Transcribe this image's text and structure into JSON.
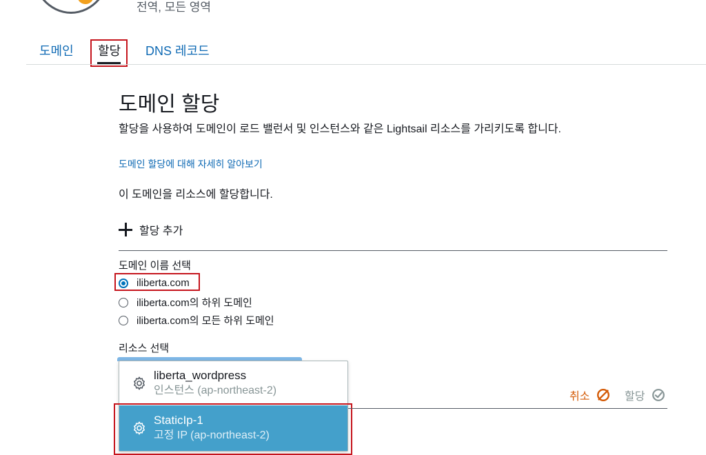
{
  "header": {
    "scope_text": "전역, 모든 영역"
  },
  "tabs": [
    {
      "label": "도메인",
      "active": false
    },
    {
      "label": "할당",
      "active": true
    },
    {
      "label": "DNS 레코드",
      "active": false
    }
  ],
  "section": {
    "title": "도메인 할당",
    "description": "할당을 사용하여 도메인이 로드 밸런서 및 인스턴스와 같은 Lightsail 리소스를 가리키도록 합니다.",
    "learn_link": "도메인 할당에 대해 자세히 알아보기",
    "assign_text": "이 도메인을 리소스에 할당합니다."
  },
  "add_assignment": {
    "label": "할당 추가"
  },
  "domain_select": {
    "label": "도메인 이름 선택",
    "options": [
      {
        "label": "iliberta.com",
        "checked": true
      },
      {
        "label": "iliberta.com의 하위 도메인",
        "checked": false
      },
      {
        "label": "iliberta.com의 모든 하위 도메인",
        "checked": false
      }
    ]
  },
  "resource_select": {
    "label": "리소스 선택",
    "options": [
      {
        "name": "liberta_wordpress",
        "sub": "인스턴스 (ap-northeast-2)",
        "icon": "gear-icon"
      },
      {
        "name": "StaticIp-1",
        "sub": "고정 IP (ap-northeast-2)",
        "icon": "gear-icon",
        "highlighted": true
      }
    ]
  },
  "actions": {
    "cancel_label": "취소",
    "assign_label": "할당"
  },
  "colors": {
    "link": "#0f6ab4",
    "highlight": "#44a0cb",
    "cancel": "#d45b07",
    "annotation": "#c5141c"
  }
}
